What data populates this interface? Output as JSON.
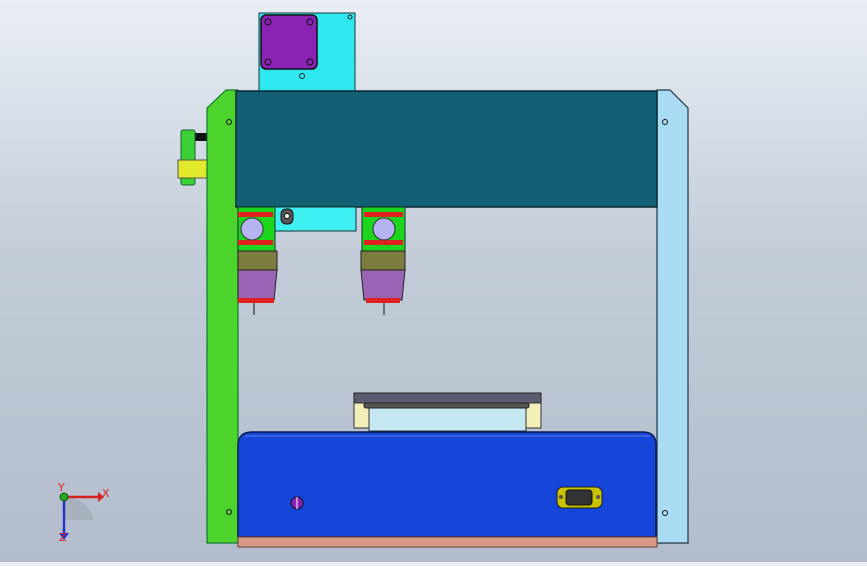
{
  "viewport": {
    "background_top": "#e9eef4",
    "background_bottom": "#b2bccb"
  },
  "model": {
    "frame_left_color": "#4cd42c",
    "frame_right_color": "#a9dcf3",
    "gantry_color": "#135f73",
    "motor_mount_color": "#2fe8ef",
    "motor_color": "#8a23b3",
    "carriage_plate_color": "#3ef0f2",
    "dispense_head_green": "#1dd51d",
    "dispense_head_red": "#e0211f",
    "dispense_head_olive": "#7c7c3e",
    "dispense_head_purple": "#9a63b4",
    "dispense_head_circle": "#b6b4f0",
    "base_color": "#1545d9",
    "fixture_color": "#c5e7f2",
    "fixture_bracket_color": "#f2efb8",
    "handwheel_color": "#3ad034",
    "handwheel_yellow": "#e2e82c",
    "base_plate_color": "#d69a86",
    "base_connector_color": "#c8c200"
  },
  "triad": {
    "x_label": "X",
    "y_label": "Y",
    "z_label": "Z",
    "x_color": "#d22222",
    "y_color": "#22aa22",
    "z_color": "#2233cc"
  }
}
